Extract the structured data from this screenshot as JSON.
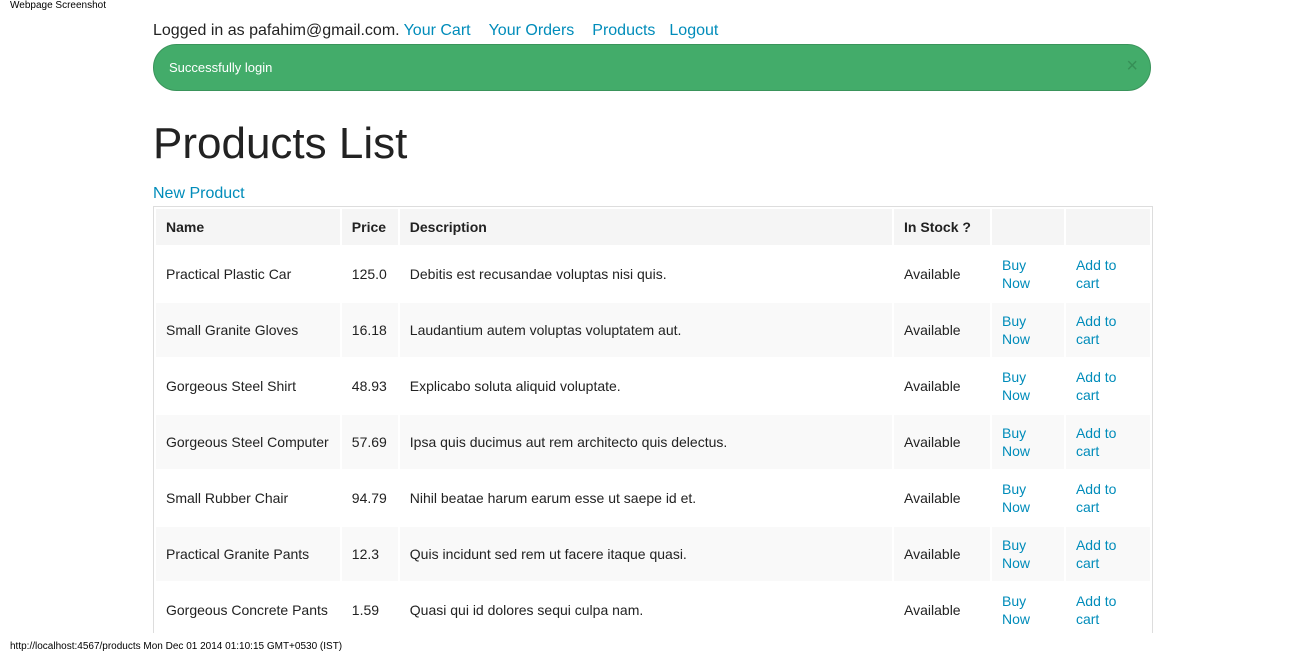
{
  "screenshot_label": "Webpage Screenshot",
  "footer_url": "http://localhost:4567/products Mon Dec 01 2014 01:10:15 GMT+0530 (IST)",
  "topbar": {
    "logged_in_text": "Logged in as pafahim@gmail.com.",
    "links": {
      "cart": "Your Cart",
      "orders": "Your Orders",
      "products": "Products",
      "logout": "Logout"
    }
  },
  "alert": {
    "message": "Successfully login",
    "close_glyph": "×",
    "color": "#43ac6a"
  },
  "page": {
    "title": "Products List",
    "new_product_label": "New Product",
    "link_color": "#008cba"
  },
  "table": {
    "headers": {
      "name": "Name",
      "price": "Price",
      "description": "Description",
      "in_stock": "In Stock ?",
      "buy": "",
      "add": ""
    },
    "rows": [
      {
        "name": "Practical Plastic Car",
        "price": "125.0",
        "description": "Debitis est recusandae voluptas nisi quis.",
        "in_stock": "Available",
        "buy": "Buy Now",
        "add": "Add to cart"
      },
      {
        "name": "Small Granite Gloves",
        "price": "16.18",
        "description": "Laudantium autem voluptas voluptatem aut.",
        "in_stock": "Available",
        "buy": "Buy Now",
        "add": "Add to cart"
      },
      {
        "name": "Gorgeous Steel Shirt",
        "price": "48.93",
        "description": "Explicabo soluta aliquid voluptate.",
        "in_stock": "Available",
        "buy": "Buy Now",
        "add": "Add to cart"
      },
      {
        "name": "Gorgeous Steel Computer",
        "price": "57.69",
        "description": "Ipsa quis ducimus aut rem architecto quis delectus.",
        "in_stock": "Available",
        "buy": "Buy Now",
        "add": "Add to cart"
      },
      {
        "name": "Small Rubber Chair",
        "price": "94.79",
        "description": "Nihil beatae harum earum esse ut saepe id et.",
        "in_stock": "Available",
        "buy": "Buy Now",
        "add": "Add to cart"
      },
      {
        "name": "Practical Granite Pants",
        "price": "12.3",
        "description": "Quis incidunt sed rem ut facere itaque quasi.",
        "in_stock": "Available",
        "buy": "Buy Now",
        "add": "Add to cart"
      },
      {
        "name": "Gorgeous Concrete Pants",
        "price": "1.59",
        "description": "Quasi qui id dolores sequi culpa nam.",
        "in_stock": "Available",
        "buy": "Buy Now",
        "add": "Add to cart"
      }
    ]
  }
}
